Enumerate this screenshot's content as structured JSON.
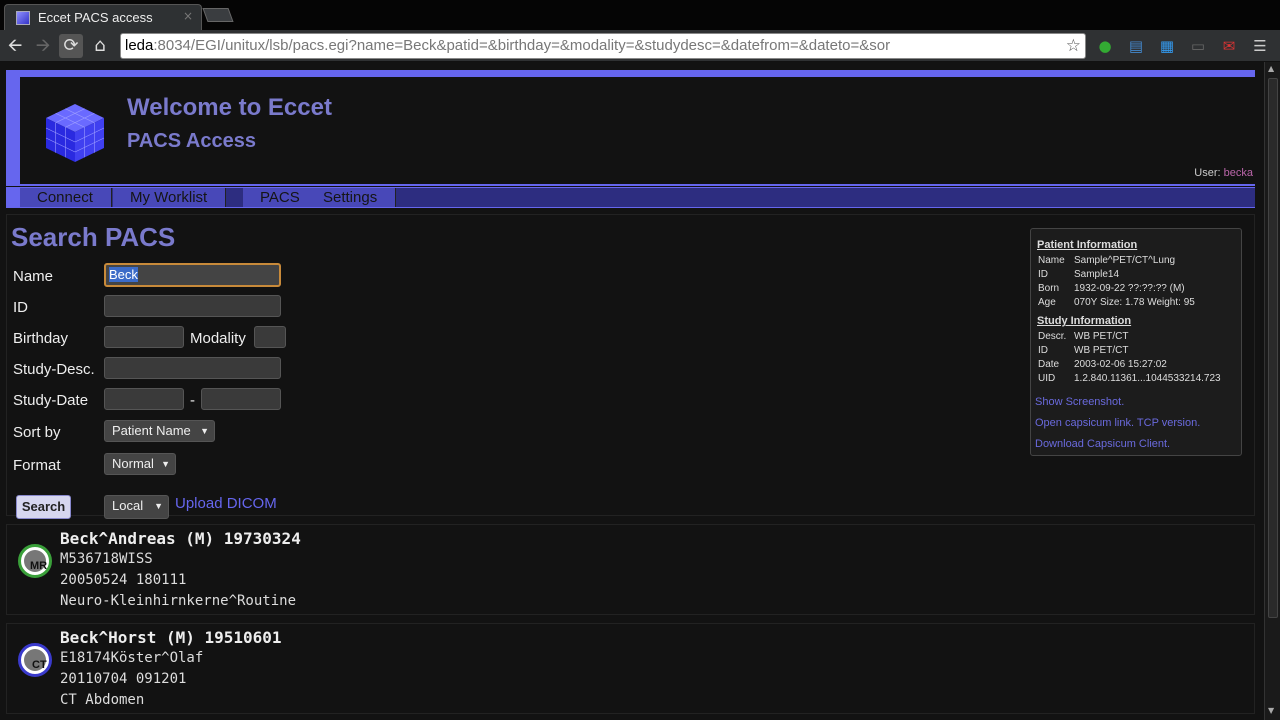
{
  "browser": {
    "tab_title": "Eccet PACS access",
    "tab_close": "×",
    "url_host": "leda",
    "url_rest": ":8034/EGI/unitux/lsb/pacs.egi?name=Beck&patid=&birthday=&modality=&studydesc=&datefrom=&dateto=&sor"
  },
  "header": {
    "title": "Welcome to Eccet",
    "subtitle": "PACS Access",
    "user_label": "User:",
    "user_name": "becka"
  },
  "menu": [
    "Connect",
    "My Worklist",
    "PACS",
    "Settings"
  ],
  "search": {
    "title": "Search PACS",
    "labels": {
      "name": "Name",
      "id": "ID",
      "birthday": "Birthday",
      "modality": "Modality",
      "study_desc": "Study-Desc.",
      "study_date": "Study-Date",
      "date_sep": "-",
      "sort_by": "Sort by",
      "format": "Format"
    },
    "values": {
      "name": "Beck",
      "id": "",
      "birthday": "",
      "modality": "",
      "study_desc": "",
      "date_from": "",
      "date_to": ""
    },
    "sort_by_selected": "Patient Name",
    "format_selected": "Normal",
    "source_selected": "Local",
    "search_button": "Search",
    "upload_link": "Upload DICOM"
  },
  "info": {
    "patient_heading": "Patient Information",
    "patient": [
      {
        "k": "Name",
        "v": "Sample^PET/CT^Lung"
      },
      {
        "k": "ID",
        "v": "Sample14"
      },
      {
        "k": "Born",
        "v": "1932-09-22 ??:??:?? (M)"
      },
      {
        "k": "Age",
        "v": "070Y Size: 1.78 Weight: 95"
      }
    ],
    "study_heading": "Study Information",
    "study": [
      {
        "k": "Descr.",
        "v": "WB PET/CT"
      },
      {
        "k": "ID",
        "v": "WB PET/CT"
      },
      {
        "k": "Date",
        "v": "2003-02-06 15:27:02"
      },
      {
        "k": "UID",
        "v": "1.2.840.11361...1044533214.723"
      }
    ],
    "links": [
      "Show Screenshot.",
      "Open capsicum link. TCP version.",
      "Download Capsicum Client."
    ]
  },
  "results": [
    {
      "modality": "MR",
      "name": "Beck^Andreas (M) 19730324",
      "line1": "M536718WISS",
      "line2": "20050524 180111",
      "line3": "Neuro-Kleinhirnkerne^Routine"
    },
    {
      "modality": "CT",
      "name": "Beck^Horst (M) 19510601",
      "line1": "E18174Köster^Olaf",
      "line2": "20110704 091201",
      "line3": "CT Abdomen"
    }
  ],
  "colors": {
    "accent": "#6666ee",
    "heading": "#7a7acc",
    "link": "#6a6add"
  }
}
